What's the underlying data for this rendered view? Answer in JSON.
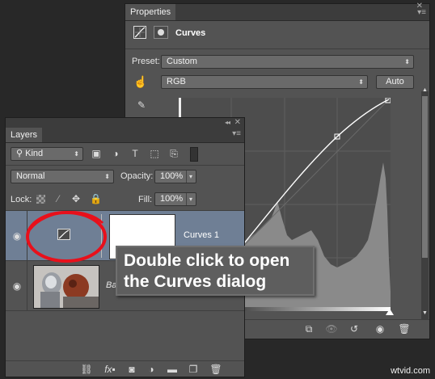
{
  "properties": {
    "tab_label": "Properties",
    "title": "Curves",
    "preset_label": "Preset:",
    "preset_value": "Custom",
    "channel_value": "RGB",
    "auto_label": "Auto"
  },
  "layers": {
    "tab_label": "Layers",
    "kind_value": "Kind",
    "blend_mode": "Normal",
    "opacity_label": "Opacity:",
    "opacity_value": "100%",
    "lock_label": "Lock:",
    "fill_label": "Fill:",
    "fill_value": "100%",
    "layer_items": [
      {
        "name": "Curves 1"
      },
      {
        "name": "Ba"
      }
    ]
  },
  "callout": {
    "line1": "Double click to open",
    "line2": "the Curves dialog"
  },
  "watermark": "wtvid.com",
  "colors": {
    "selected_layer": "#6f7f95",
    "annotation_red": "#e8101b",
    "panel_bg": "#535353"
  },
  "icons": [
    "curves-adjustment-icon",
    "layer-mask-icon",
    "hand-target-icon",
    "eyedropper-icon",
    "eye-icon",
    "lock-icon",
    "trash-icon",
    "fx-icon",
    "link-icon",
    "folder-icon",
    "new-layer-icon",
    "reset-icon",
    "clip-icon"
  ]
}
